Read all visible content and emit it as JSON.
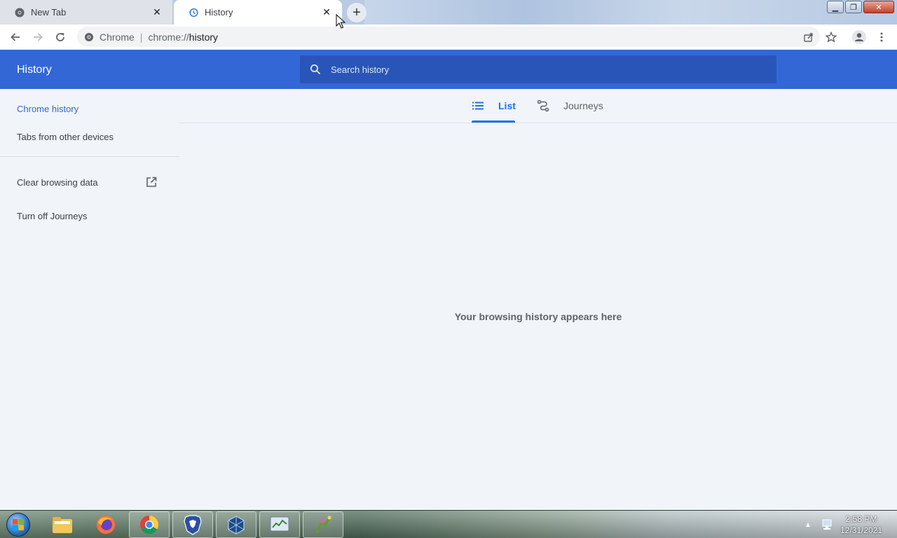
{
  "browser": {
    "tabs": [
      {
        "title": "New Tab",
        "active": false
      },
      {
        "title": "History",
        "active": true
      }
    ],
    "omnibox": {
      "site_label": "Chrome",
      "url_prefix": "chrome://",
      "url_path": "history"
    }
  },
  "history": {
    "header_title": "History",
    "search_placeholder": "Search history",
    "sidebar": {
      "items": [
        {
          "label": "Chrome history",
          "selected": true
        },
        {
          "label": "Tabs from other devices",
          "selected": false
        },
        {
          "label": "Clear browsing data",
          "external": true
        },
        {
          "label": "Turn off Journeys"
        }
      ]
    },
    "view_tabs": [
      {
        "label": "List",
        "icon": "list-icon",
        "active": true
      },
      {
        "label": "Journeys",
        "icon": "journeys-icon",
        "active": false
      }
    ],
    "empty_message": "Your browsing history appears here"
  },
  "taskbar": {
    "apps": [
      "file-explorer-icon",
      "firefox-icon",
      "chrome-icon",
      "brave-icon",
      "virtualbox-icon",
      "task-manager-icon",
      "app-icon"
    ],
    "time": "2:58 PM",
    "date": "12/31/2021"
  },
  "colors": {
    "header_blue": "#3367d6",
    "search_blue": "#2a55b8",
    "accent_blue": "#1a73e8",
    "page_bg": "#f1f4f9"
  }
}
